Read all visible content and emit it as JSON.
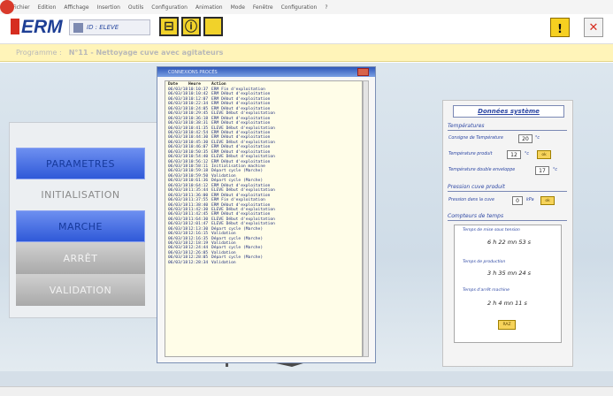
{
  "menu": [
    "Fichier",
    "Edition",
    "Affichage",
    "Insertion",
    "Outils",
    "Configuration",
    "Animation",
    "Mode",
    "Fenêtre",
    "Configuration",
    "?"
  ],
  "app": {
    "logo": "ERM",
    "user": "ID : ELEVE"
  },
  "toolbar": {
    "btn1": "⊟",
    "btn2": "ⓘ",
    "btn3": "",
    "warn": "!",
    "close": "✕"
  },
  "program": {
    "label": "Programme :",
    "value": "N°11 - Nettoyage cuve avec agitateurs"
  },
  "left_panel": {
    "items": [
      "PARAMETRES",
      "INITIALISATION",
      "MARCHE",
      "ARRÊT",
      "VALIDATION"
    ]
  },
  "dialog": {
    "title": "CONNEXIONS PROCÉS",
    "headers": [
      "Date",
      "Heure",
      "Action"
    ],
    "rows": [
      [
        "06/03/18",
        "10:10:37",
        "ERM Fin d'exploitation"
      ],
      [
        "06/03/18",
        "10:10:42",
        "ERM Début d'exploitation"
      ],
      [
        "06/03/18",
        "10:12:07",
        "ERM Début d'exploitation"
      ],
      [
        "06/03/18",
        "10:22:34",
        "ERM Début d'exploitation"
      ],
      [
        "06/03/18",
        "10:24:05",
        "ERM Début d'exploitation"
      ],
      [
        "06/03/18",
        "10:29:45",
        "ELEVE Début d'exploitation"
      ],
      [
        "06/03/18",
        "10:36:18",
        "ERM Début d'exploitation"
      ],
      [
        "06/03/18",
        "10:38:31",
        "ERM Début d'exploitation"
      ],
      [
        "06/03/18",
        "10:41:35",
        "ELEVE Début d'exploitation"
      ],
      [
        "06/03/18",
        "10:42:54",
        "ERM Début d'exploitation"
      ],
      [
        "06/03/18",
        "10:44:30",
        "ERM Début d'exploitation"
      ],
      [
        "06/03/18",
        "10:45:30",
        "ELEVE Début d'exploitation"
      ],
      [
        "06/03/18",
        "10:46:07",
        "ERM Début d'exploitation"
      ],
      [
        "06/03/18",
        "10:50:35",
        "ERM Début d'exploitation"
      ],
      [
        "06/03/18",
        "10:54:40",
        "ELEVE Début d'exploitation"
      ],
      [
        "06/03/18",
        "10:56:12",
        "ERM Début d'exploitation"
      ],
      [
        "06/03/18",
        "10:58:11",
        "Initialisation machine"
      ],
      [
        "06/03/18",
        "10:59:18",
        "Départ cycle (Marche)"
      ],
      [
        "06/03/18",
        "10:59:50",
        "Validation"
      ],
      [
        "06/03/18",
        "10:61:36",
        "Départ cycle (Marche)"
      ],
      [
        "06/03/18",
        "10:64:12",
        "ERM Début d'exploitation"
      ],
      [
        "06/03/18",
        "11:35:44",
        "ELEVE Début d'exploitation"
      ],
      [
        "06/03/18",
        "11:36:00",
        "ERM Début d'exploitation"
      ],
      [
        "06/03/18",
        "11:37:55",
        "ERM Fin d'exploitation"
      ],
      [
        "06/03/18",
        "11:38:40",
        "ERM Début d'exploitation"
      ],
      [
        "06/03/18",
        "11:42:30",
        "ELEVE Début d'exploitation"
      ],
      [
        "06/03/18",
        "11:42:45",
        "ERM Début d'exploitation"
      ],
      [
        "06/03/18",
        "11:64:30",
        "ELEVE Début d'exploitation"
      ],
      [
        "06/03/18",
        "12:01:47",
        "ELEVE Début d'exploitation"
      ],
      [
        "06/03/18",
        "12:13:30",
        "Départ cycle (Marche)"
      ],
      [
        "06/03/18",
        "12:16:15",
        "Validation"
      ],
      [
        "06/03/18",
        "12:16:35",
        "Départ cycle (Marche)"
      ],
      [
        "06/03/18",
        "12:18:19",
        "Validation"
      ],
      [
        "06/03/18",
        "12:24:44",
        "Départ cycle (Marche)"
      ],
      [
        "06/03/18",
        "12:26:05",
        "Validation"
      ],
      [
        "06/03/18",
        "12:28:05",
        "Départ cycle (Marche)"
      ],
      [
        "06/03/18",
        "12:28:34",
        "Validation"
      ]
    ]
  },
  "system": {
    "title": "Données système",
    "temp_section": "Températures",
    "temp": [
      {
        "label": "Consigne de Température",
        "value": "20",
        "unit": "°c"
      },
      {
        "label": "Température produit",
        "value": "12",
        "unit": "°c",
        "btn": "ok"
      },
      {
        "label": "Température double enveloppe",
        "value": "17",
        "unit": "°c"
      }
    ],
    "press_section": "Pression cuve produit",
    "press": {
      "label": "Pression dans la cuve",
      "value": "0",
      "unit": "kPa",
      "btn": "ok"
    },
    "time_section": "Compteurs de temps",
    "timers": [
      {
        "label": "Temps de mise sous tension",
        "h": "6",
        "m": "22",
        "s": "53"
      },
      {
        "label": "Temps de production",
        "h": "3",
        "m": "35",
        "s": "24"
      },
      {
        "label": "Temps d'arrêt machine",
        "h": "2",
        "m": "4",
        "s": "11"
      }
    ],
    "units": {
      "h": "h",
      "m": "mn",
      "s": "s"
    },
    "raz": "RAZ"
  },
  "colors": {
    "accent_blue": "#2f59d8",
    "header_yellow": "#f1d22a",
    "program_bar": "#fff4b9"
  },
  "icons": [
    "user-icon",
    "panel-icon",
    "info-icon",
    "blank-icon",
    "warning-icon",
    "close-icon"
  ]
}
